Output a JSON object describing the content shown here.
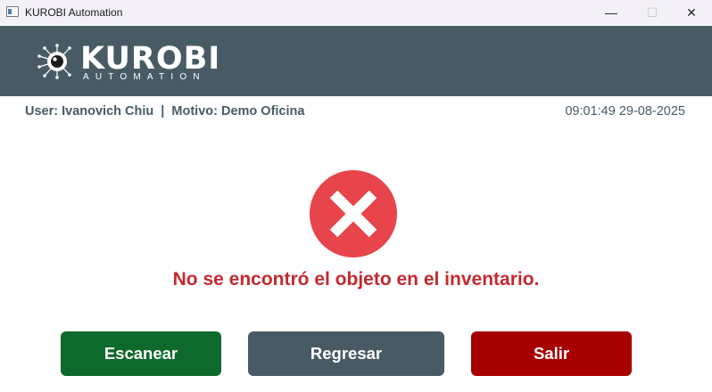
{
  "window": {
    "title": "KUROBI Automation",
    "minimize_glyph": "—",
    "maximize_glyph": "☐",
    "close_glyph": "✕"
  },
  "logo": {
    "word": "KUROBI",
    "subtitle": "AUTOMATION",
    "icon": "circuit-eye-icon"
  },
  "info": {
    "user_line": "User: Ivanovich Chiu  |  Motivo: Demo Oficina",
    "datetime": "09:01:49 29-08-2025"
  },
  "status": {
    "icon": "error-x-icon",
    "message": "No se encontró el objeto en el inventario."
  },
  "buttons": {
    "scan": "Escanear",
    "back": "Regresar",
    "exit": "Salir"
  },
  "colors": {
    "banner": "#485b65",
    "error": "#e8444b",
    "message": "#c3292f",
    "scan_button": "#0e6a2c",
    "back_button": "#485b65",
    "exit_button": "#a80000"
  }
}
